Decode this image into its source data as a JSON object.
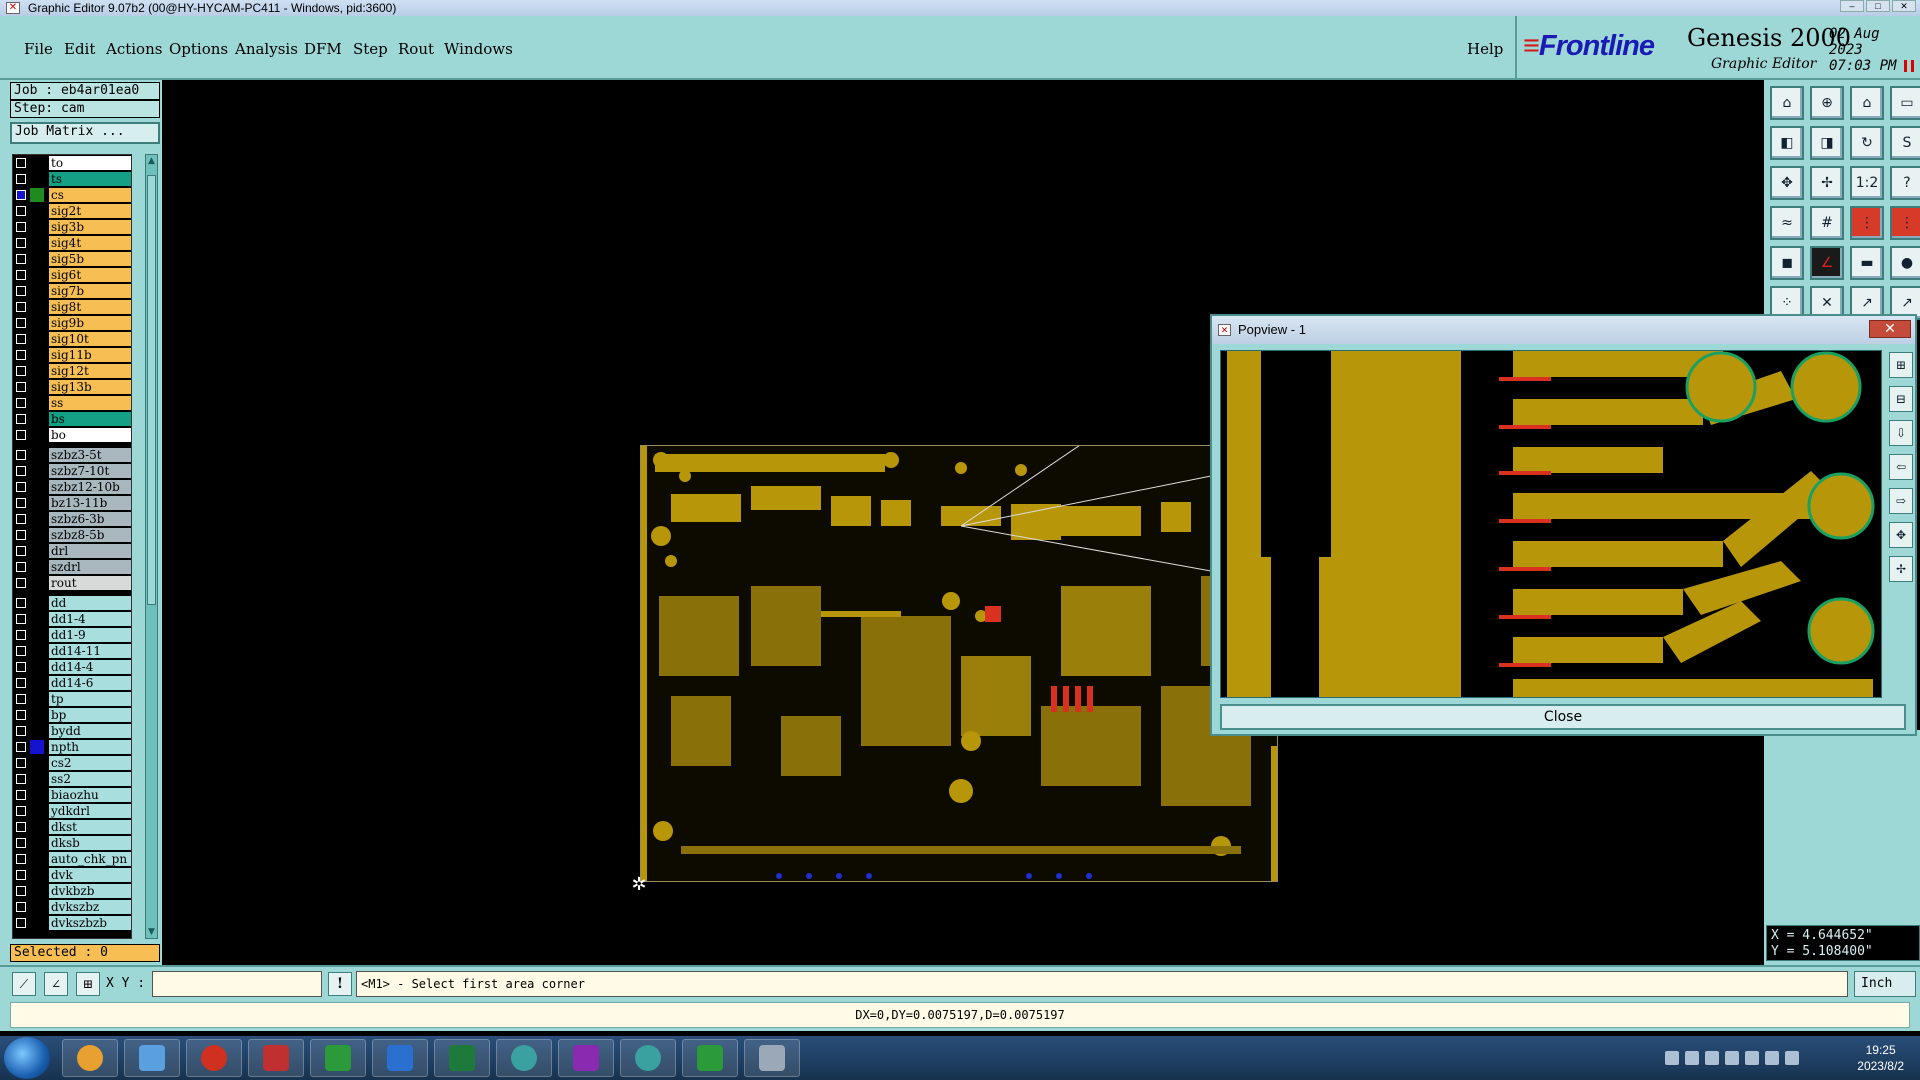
{
  "window": {
    "title": "Graphic Editor 9.07b2 (00@HY-HYCAM-PC411 - Windows, pid:3600)"
  },
  "menu": [
    "File",
    "Edit",
    "Actions",
    "Options",
    "Analysis",
    "DFM",
    "Step",
    "Rout",
    "Windows"
  ],
  "help_label": "Help",
  "brand": {
    "logo": "Frontline",
    "product": "Genesis 2000",
    "subtitle": "Graphic Editor",
    "date": "02 Aug 2023",
    "time": "07:03 PM"
  },
  "job": {
    "job_label": "Job : eb4ar01ea0",
    "step_label": "Step: cam",
    "matrix_button": "Job Matrix ..."
  },
  "layers": [
    {
      "name": "to",
      "color": "#ffffff",
      "swatch": "#000000"
    },
    {
      "name": "ts",
      "color": "#14a085",
      "swatch": "#000000"
    },
    {
      "name": "cs",
      "color": "#f7bf53",
      "swatch": "#1f8a1f",
      "active": true
    },
    {
      "name": "sig2t",
      "color": "#f7bf53",
      "swatch": "#000000"
    },
    {
      "name": "sig3b",
      "color": "#f7bf53",
      "swatch": "#000000"
    },
    {
      "name": "sig4t",
      "color": "#f7bf53",
      "swatch": "#000000"
    },
    {
      "name": "sig5b",
      "color": "#f7bf53",
      "swatch": "#000000"
    },
    {
      "name": "sig6t",
      "color": "#f7bf53",
      "swatch": "#000000"
    },
    {
      "name": "sig7b",
      "color": "#f7bf53",
      "swatch": "#000000"
    },
    {
      "name": "sig8t",
      "color": "#f7bf53",
      "swatch": "#000000"
    },
    {
      "name": "sig9b",
      "color": "#f7bf53",
      "swatch": "#000000"
    },
    {
      "name": "sig10t",
      "color": "#f7bf53",
      "swatch": "#000000"
    },
    {
      "name": "sig11b",
      "color": "#f7bf53",
      "swatch": "#000000"
    },
    {
      "name": "sig12t",
      "color": "#f7bf53",
      "swatch": "#000000"
    },
    {
      "name": "sig13b",
      "color": "#f7bf53",
      "swatch": "#000000"
    },
    {
      "name": "ss",
      "color": "#f7bf53",
      "swatch": "#000000"
    },
    {
      "name": "bs",
      "color": "#14a085",
      "swatch": "#000000"
    },
    {
      "name": "bo",
      "color": "#ffffff",
      "swatch": "#000000"
    },
    {
      "name": "szbz3-5t",
      "color": "#a8b8be",
      "swatch": "#000000",
      "gap": true
    },
    {
      "name": "szbz7-10t",
      "color": "#a8b8be",
      "swatch": "#000000"
    },
    {
      "name": "szbz12-10b",
      "color": "#a8b8be",
      "swatch": "#000000"
    },
    {
      "name": "bz13-11b",
      "color": "#a8b8be",
      "swatch": "#000000"
    },
    {
      "name": "szbz6-3b",
      "color": "#a8b8be",
      "swatch": "#000000"
    },
    {
      "name": "szbz8-5b",
      "color": "#a8b8be",
      "swatch": "#000000"
    },
    {
      "name": "drl",
      "color": "#a8b8be",
      "swatch": "#000000"
    },
    {
      "name": "szdrl",
      "color": "#a8b8be",
      "swatch": "#000000"
    },
    {
      "name": "rout",
      "color": "#d8dada",
      "swatch": "#000000"
    },
    {
      "name": "dd",
      "color": "#a9dede",
      "swatch": "#000000",
      "gap": true
    },
    {
      "name": "dd1-4",
      "color": "#a9dede",
      "swatch": "#000000"
    },
    {
      "name": "dd1-9",
      "color": "#a9dede",
      "swatch": "#000000"
    },
    {
      "name": "dd14-11",
      "color": "#a9dede",
      "swatch": "#000000"
    },
    {
      "name": "dd14-4",
      "color": "#a9dede",
      "swatch": "#000000"
    },
    {
      "name": "dd14-6",
      "color": "#a9dede",
      "swatch": "#000000"
    },
    {
      "name": "tp",
      "color": "#a9dede",
      "swatch": "#000000"
    },
    {
      "name": "bp",
      "color": "#a9dede",
      "swatch": "#000000"
    },
    {
      "name": "bydd",
      "color": "#a9dede",
      "swatch": "#000000"
    },
    {
      "name": "npth",
      "color": "#a9dede",
      "swatch": "#1414d0"
    },
    {
      "name": "cs2",
      "color": "#a9dede",
      "swatch": "#000000"
    },
    {
      "name": "ss2",
      "color": "#a9dede",
      "swatch": "#000000"
    },
    {
      "name": "biaozhu",
      "color": "#a9dede",
      "swatch": "#000000"
    },
    {
      "name": "ydkdrl",
      "color": "#a9dede",
      "swatch": "#000000"
    },
    {
      "name": "dkst",
      "color": "#a9dede",
      "swatch": "#000000"
    },
    {
      "name": "dksb",
      "color": "#a9dede",
      "swatch": "#000000"
    },
    {
      "name": "auto_chk_pn",
      "color": "#a9dede",
      "swatch": "#000000"
    },
    {
      "name": "dvk",
      "color": "#a9dede",
      "swatch": "#000000"
    },
    {
      "name": "dvkbzb",
      "color": "#a9dede",
      "swatch": "#000000"
    },
    {
      "name": "dvkszbz",
      "color": "#a9dede",
      "swatch": "#000000"
    },
    {
      "name": "dvkszbzb",
      "color": "#a9dede",
      "swatch": "#000000"
    }
  ],
  "selected_label": "Selected : 0",
  "popview": {
    "title": "Popview - 1",
    "close_label": "Close"
  },
  "coords": {
    "x": "X = 4.644652\"",
    "y": "Y = 5.108400\""
  },
  "command": {
    "xy_label": "X Y :",
    "xy_value": "",
    "prompt": "<M1> - Select first area corner",
    "unit": "Inch"
  },
  "status": "DX=0,DY=0.0075197,D=0.0075197",
  "taskbar": {
    "time": "19:25",
    "date": "2023/8/2"
  },
  "colors": {
    "panel": "#9ed8d6",
    "copper": "#b8960a",
    "trace": "#c29c0c"
  }
}
